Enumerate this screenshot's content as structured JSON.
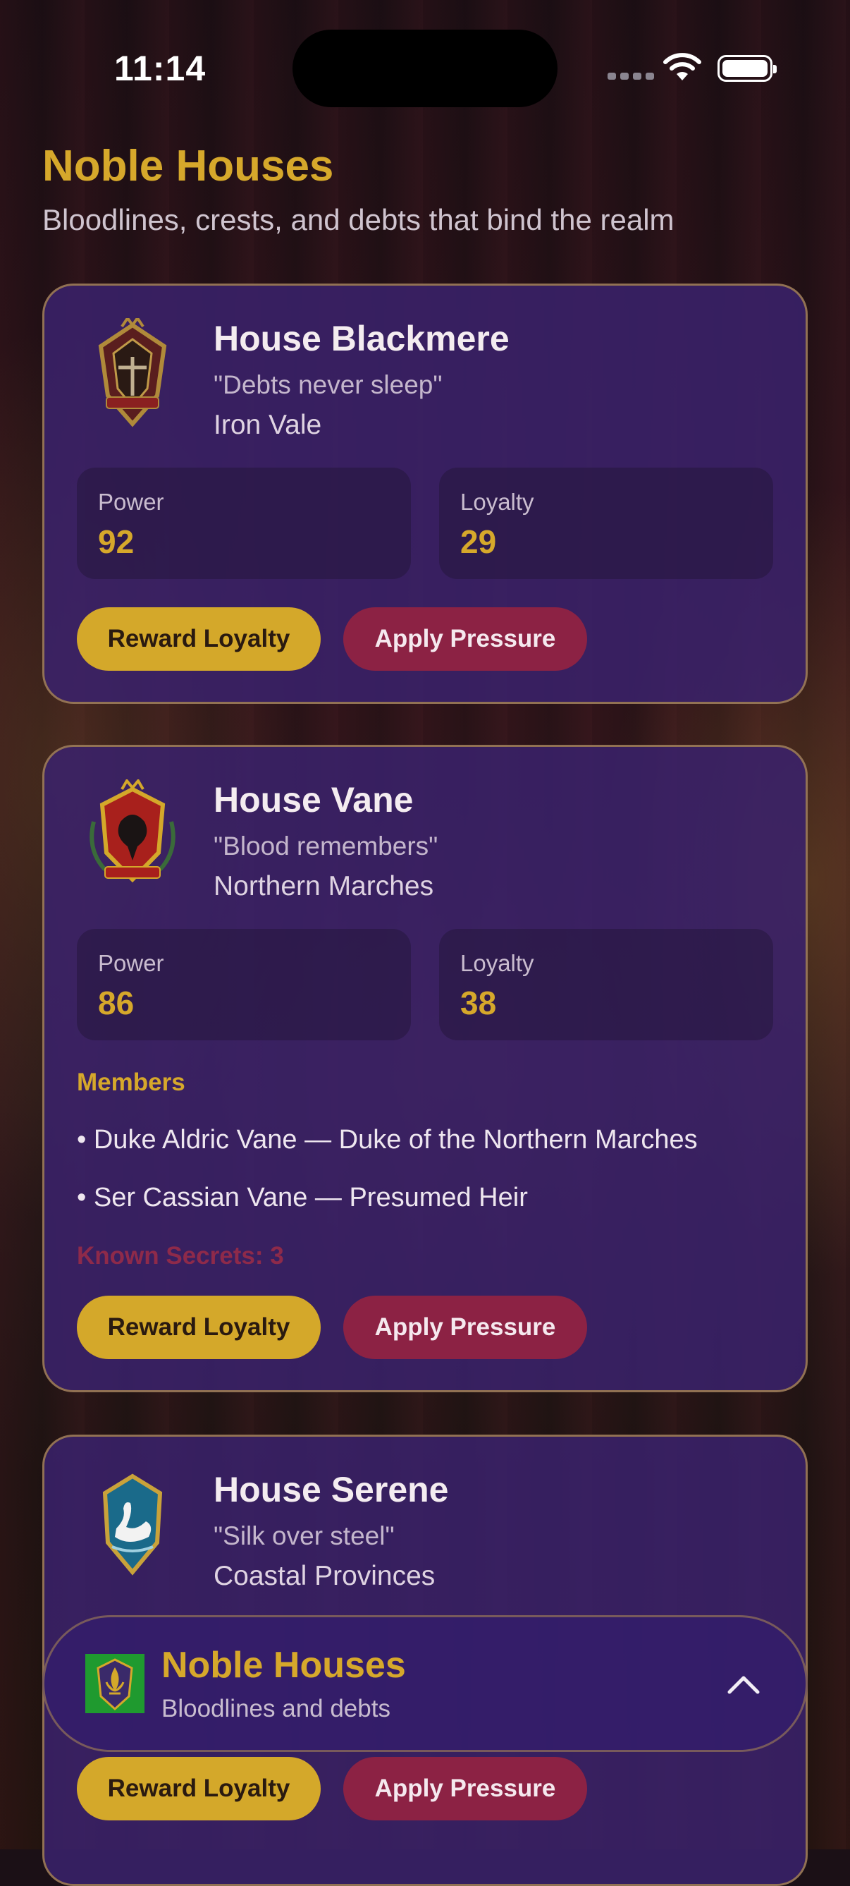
{
  "status": {
    "time": "11:14"
  },
  "header": {
    "title": "Noble Houses",
    "subtitle": "Bloodlines, crests, and debts that bind the realm"
  },
  "houses": [
    {
      "name": "House Blackmere",
      "motto": "\"Debts never sleep\"",
      "region": "Iron Vale",
      "power_label": "Power",
      "power": "92",
      "loyalty_label": "Loyalty",
      "loyalty": "29",
      "reward_label": "Reward Loyalty",
      "pressure_label": "Apply Pressure"
    },
    {
      "name": "House Vane",
      "motto": "\"Blood remembers\"",
      "region": "Northern Marches",
      "power_label": "Power",
      "power": "86",
      "loyalty_label": "Loyalty",
      "loyalty": "38",
      "members_heading": "Members",
      "members": [
        "• Duke Aldric Vane — Duke of the Northern Marches",
        "• Ser Cassian Vane — Presumed Heir"
      ],
      "secrets": "Known Secrets: 3",
      "reward_label": "Reward Loyalty",
      "pressure_label": "Apply Pressure"
    },
    {
      "name": "House Serene",
      "motto": "\"Silk over steel\"",
      "region": "Coastal Provinces",
      "reward_label": "Reward Loyalty",
      "pressure_label": "Apply Pressure"
    }
  ],
  "dock": {
    "title": "Noble Houses",
    "subtitle": "Bloodlines and debts"
  },
  "colors": {
    "accent_gold": "#d6a82b",
    "pressure_crimson": "#8c2244",
    "card_purple": "#3a226c",
    "card_border": "#b08e50"
  }
}
